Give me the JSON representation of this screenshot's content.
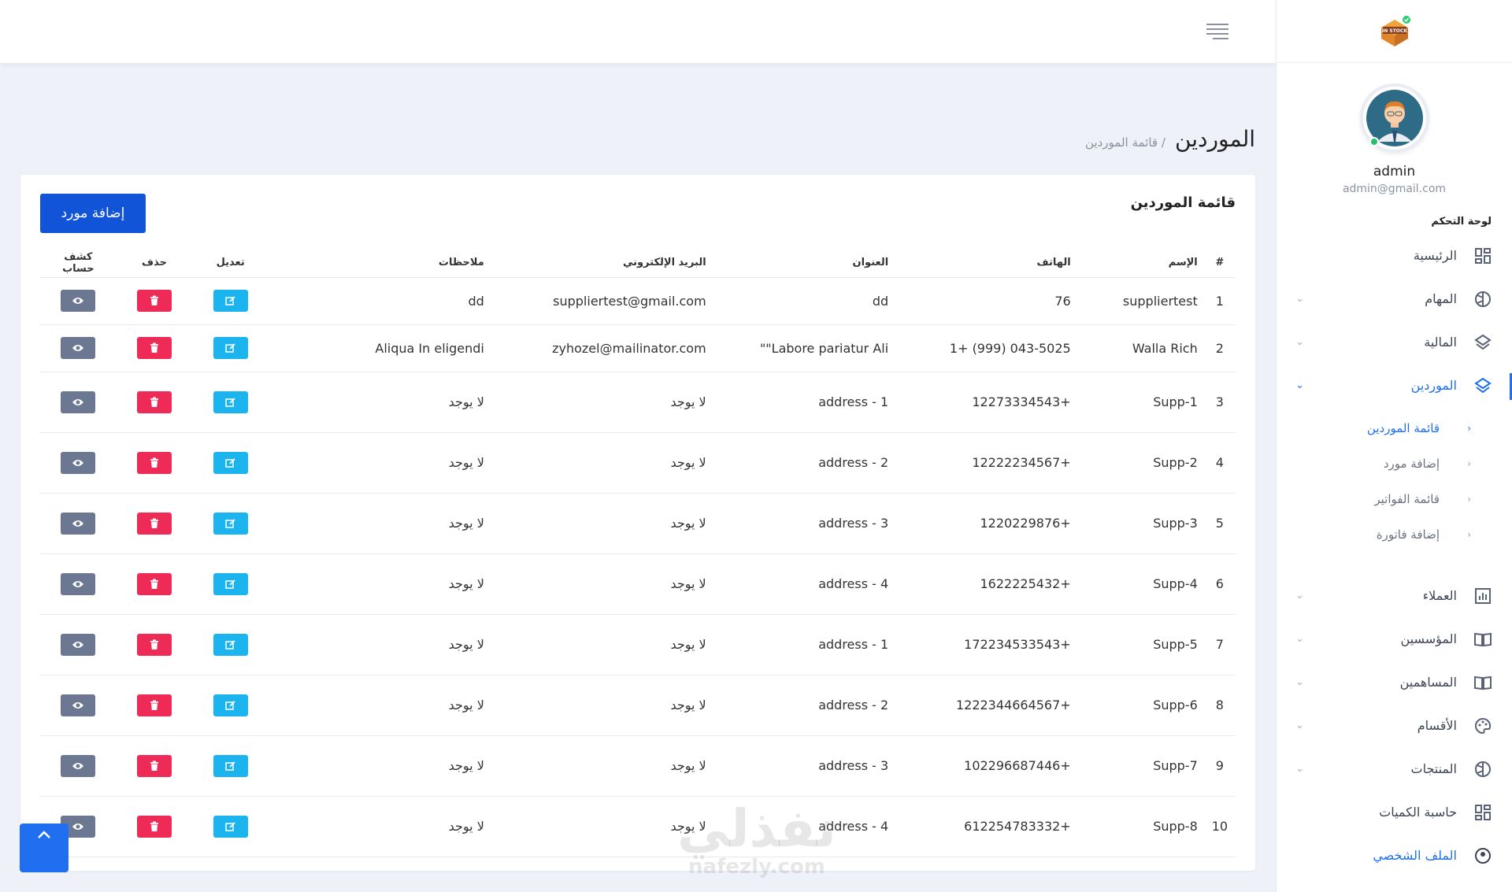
{
  "topbar": {
    "menu_icon": "menu-lines-icon"
  },
  "sidebar": {
    "logo_text": "IN STOCK",
    "user": {
      "name": "admin",
      "email": "admin@gmail.com"
    },
    "section_title": "لوحة التحكم",
    "items": [
      {
        "label": "الرئيسية",
        "icon": "grid-icon",
        "chevron": ""
      },
      {
        "label": "المهام",
        "icon": "globe-icon",
        "chevron": "⌄"
      },
      {
        "label": "المالية",
        "icon": "layers-icon",
        "chevron": "⌄"
      },
      {
        "label": "الموردين",
        "icon": "layers-icon",
        "chevron": "⌄"
      }
    ],
    "subitems": [
      {
        "label": "قائمة الموردين",
        "chevron": "‹"
      },
      {
        "label": "إضافة مورد",
        "chevron": "‹"
      },
      {
        "label": "قائمة الفواتير",
        "chevron": "‹"
      },
      {
        "label": "إضافة فاتورة",
        "chevron": "‹"
      }
    ],
    "items2": [
      {
        "label": "العملاء",
        "icon": "chart-icon",
        "chevron": "⌄"
      },
      {
        "label": "المؤسسين",
        "icon": "book-icon",
        "chevron": "⌄"
      },
      {
        "label": "المساهمين",
        "icon": "book-icon",
        "chevron": "⌄"
      },
      {
        "label": "الأقسام",
        "icon": "palette-icon",
        "chevron": "⌄"
      },
      {
        "label": "المنتجات",
        "icon": "globe-icon",
        "chevron": "⌄"
      },
      {
        "label": "حاسبة الكميات",
        "icon": "grid-icon",
        "chevron": ""
      },
      {
        "label": "الملف الشخصي",
        "icon": "user-icon",
        "chevron": ""
      }
    ]
  },
  "page": {
    "title": "الموردين",
    "breadcrumb": "/ قائمة الموردين"
  },
  "card": {
    "title": "قائمة الموردين",
    "add_button": "إضافة مورد",
    "headers": {
      "num": "#",
      "name": "الإسم",
      "phone": "الهاتف",
      "address": "العنوان",
      "email": "البريد الإلكتروني",
      "notes": "ملاحظات",
      "edit": "تعديل",
      "delete": "حذف",
      "statement": "كشف حساب"
    },
    "rows": [
      {
        "num": "1",
        "name": "suppliertest",
        "phone": "76",
        "address": "dd",
        "email": "suppliertest@gmail.com",
        "notes": "dd"
      },
      {
        "num": "2",
        "name": "Walla Rich",
        "phone": "1+ (999) 043-5025",
        "address": "Labore pariatur Ali\"\"",
        "email": "zyhozel@mailinator.com",
        "notes": "Aliqua In eligendi"
      },
      {
        "num": "3",
        "name": "Supp-1",
        "phone": "12273334543+",
        "address": "address - 1",
        "email": "لا يوجد",
        "notes": "لا يوجد"
      },
      {
        "num": "4",
        "name": "Supp-2",
        "phone": "12222234567+",
        "address": "address - 2",
        "email": "لا يوجد",
        "notes": "لا يوجد"
      },
      {
        "num": "5",
        "name": "Supp-3",
        "phone": "1220229876+",
        "address": "address - 3",
        "email": "لا يوجد",
        "notes": "لا يوجد"
      },
      {
        "num": "6",
        "name": "Supp-4",
        "phone": "1622225432+",
        "address": "address - 4",
        "email": "لا يوجد",
        "notes": "لا يوجد"
      },
      {
        "num": "7",
        "name": "Supp-5",
        "phone": "172234533543+",
        "address": "address - 1",
        "email": "لا يوجد",
        "notes": "لا يوجد"
      },
      {
        "num": "8",
        "name": "Supp-6",
        "phone": "1222344664567+",
        "address": "address - 2",
        "email": "لا يوجد",
        "notes": "لا يوجد"
      },
      {
        "num": "9",
        "name": "Supp-7",
        "phone": "102296687446+",
        "address": "address - 3",
        "email": "لا يوجد",
        "notes": "لا يوجد"
      },
      {
        "num": "10",
        "name": "Supp-8",
        "phone": "612254783332+",
        "address": "address - 4",
        "email": "لا يوجد",
        "notes": "لا يوجد"
      }
    ]
  },
  "scroll_top_icon": "chevron-up-icon",
  "watermark": {
    "line1": "نفذلي",
    "line2": "nafezly.com"
  },
  "colors": {
    "primary": "#1f6ff0",
    "add_button": "#1254d8",
    "edit": "#1bb4ef",
    "delete": "#ee2a57",
    "view": "#6c7791"
  }
}
